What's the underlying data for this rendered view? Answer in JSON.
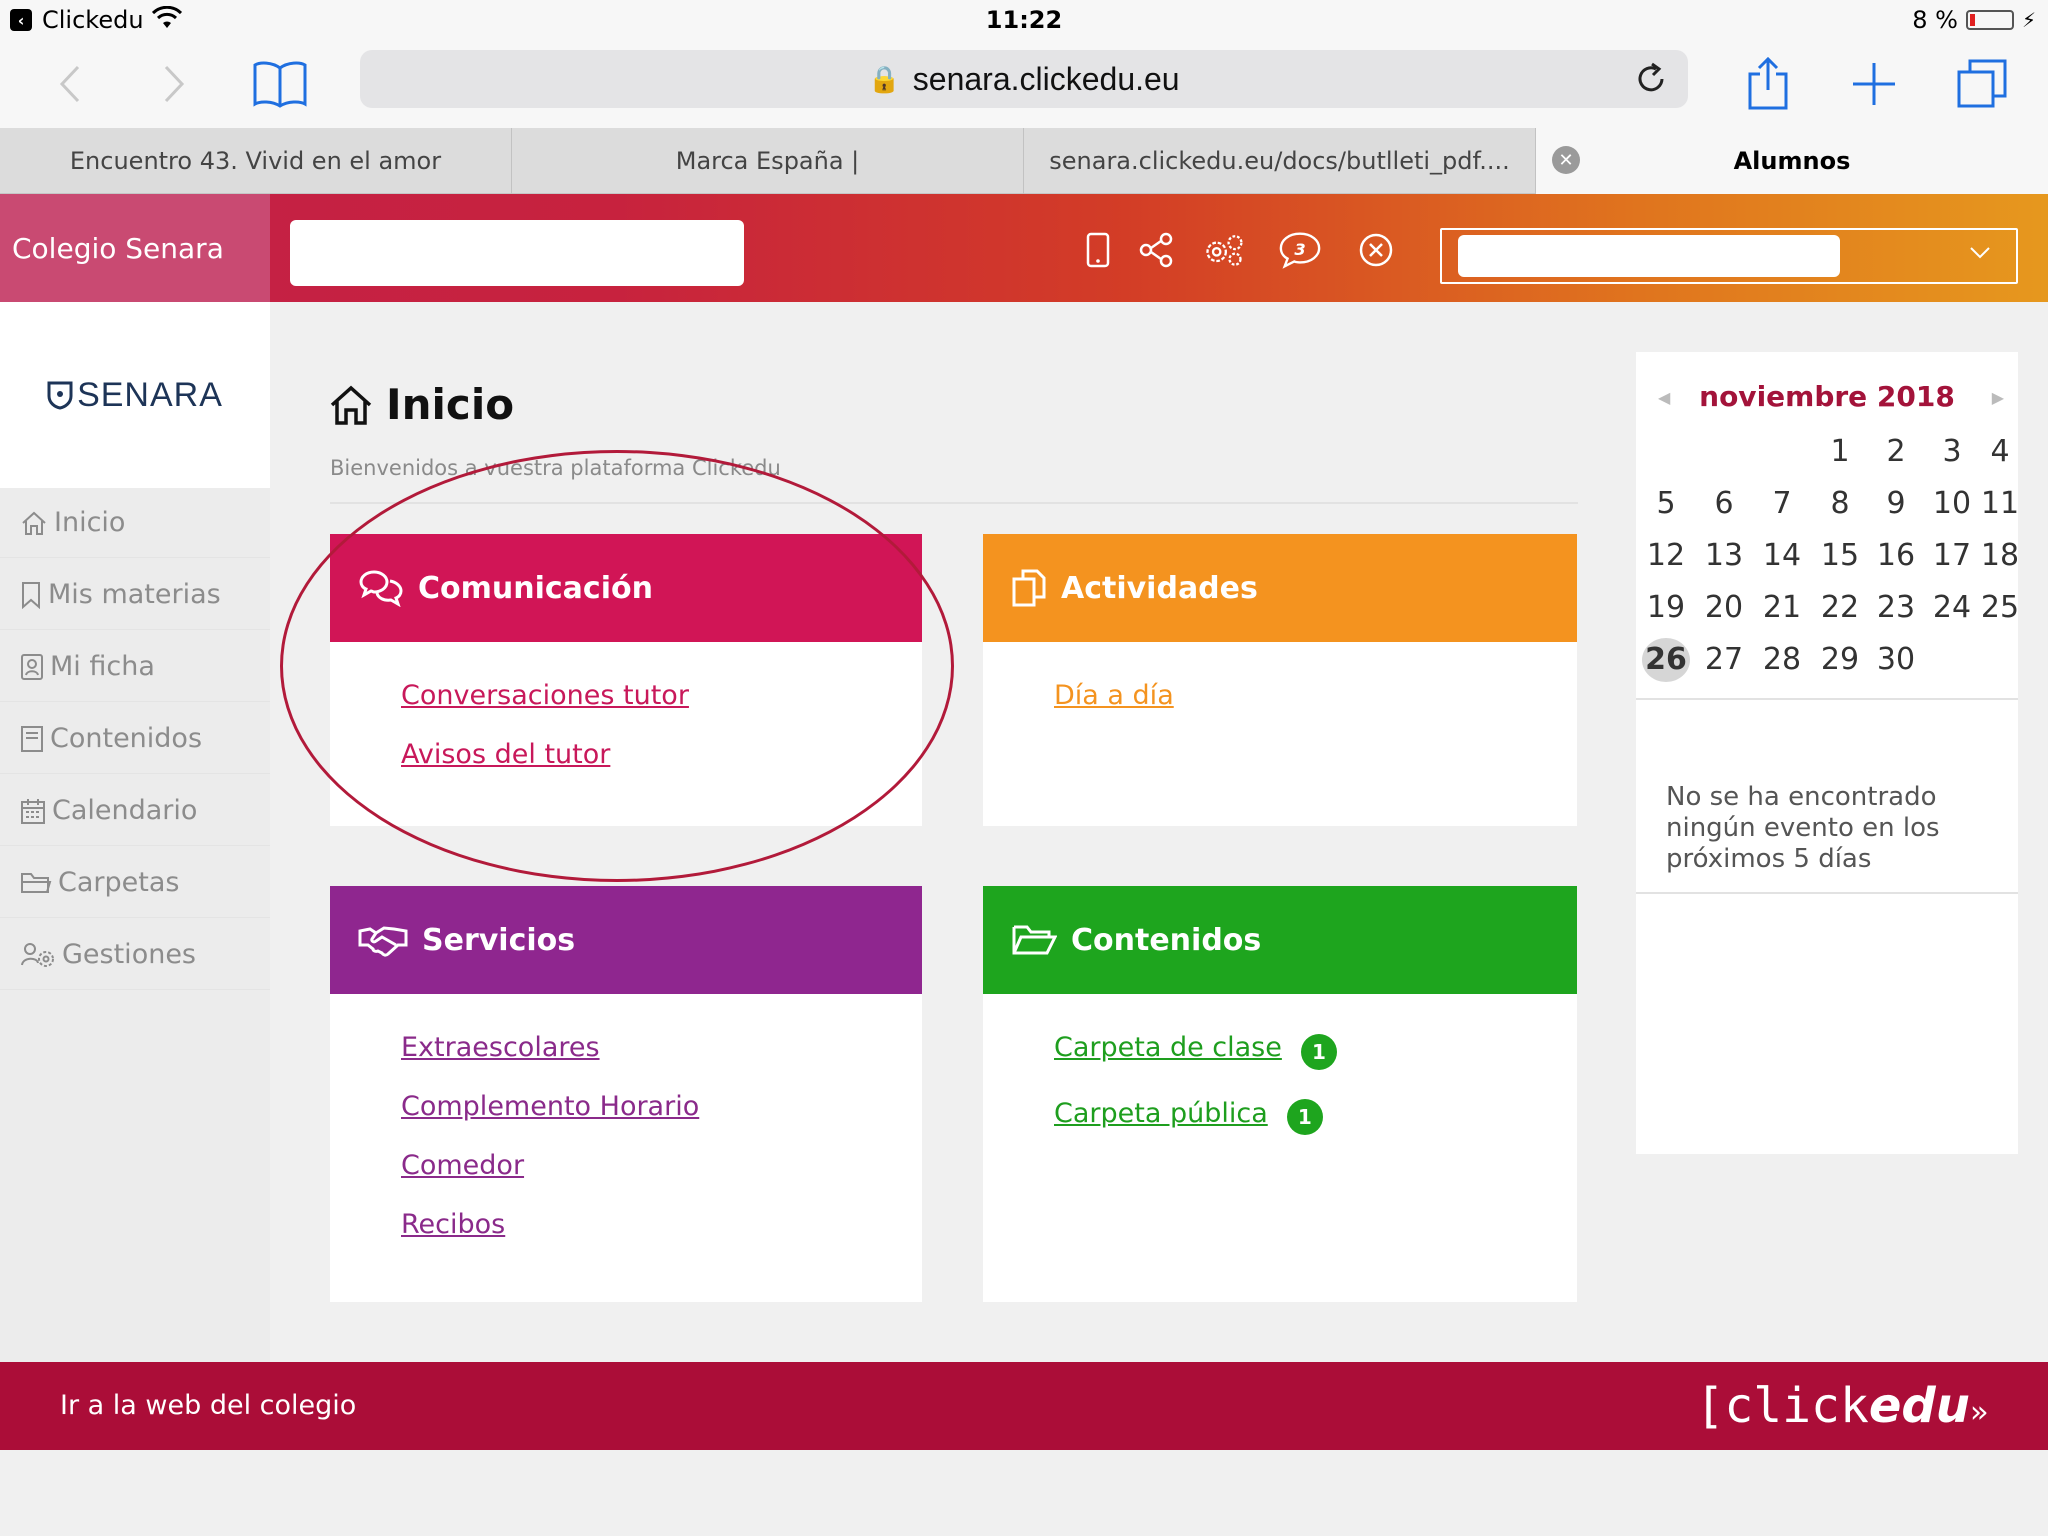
{
  "status_bar": {
    "back_app": "Clickedu",
    "time": "11:22",
    "battery": "8 %"
  },
  "browser": {
    "url": "senara.clickedu.eu",
    "tabs": [
      {
        "label": "Encuentro 43. Vivid en el amor"
      },
      {
        "label": "Marca España |"
      },
      {
        "label": "senara.clickedu.eu/docs/butlleti_pdf...."
      },
      {
        "label": "Alumnos"
      }
    ]
  },
  "header": {
    "brand": "Colegio Senara",
    "search_value": "",
    "user_select_value": "",
    "notifications_count": "3"
  },
  "sidebar": {
    "logo": "SENARA",
    "items": [
      {
        "label": "Inicio",
        "icon": "home-icon"
      },
      {
        "label": "Mis materias",
        "icon": "bookmark-icon"
      },
      {
        "label": "Mi ficha",
        "icon": "id-card-icon"
      },
      {
        "label": "Contenidos",
        "icon": "book-icon"
      },
      {
        "label": "Calendario",
        "icon": "calendar-icon"
      },
      {
        "label": "Carpetas",
        "icon": "folder-icon"
      },
      {
        "label": "Gestiones",
        "icon": "users-gear-icon"
      }
    ]
  },
  "main": {
    "title": "Inicio",
    "subtitle": "Bienvenidos a vuestra plataforma Clickedu",
    "cards": {
      "comunicacion": {
        "title": "Comunicación",
        "color": "#d11556",
        "links": [
          "Conversaciones tutor",
          "Avisos del tutor"
        ]
      },
      "actividades": {
        "title": "Actividades",
        "color": "#f4931f",
        "links": [
          "Día a día"
        ]
      },
      "servicios": {
        "title": "Servicios",
        "color": "#8f268f",
        "links": [
          "Extraescolares",
          "Complemento Horario",
          "Comedor",
          "Recibos"
        ]
      },
      "contenidos": {
        "title": "Contenidos",
        "color": "#1ea51e",
        "links": [
          "Carpeta de clase",
          "Carpeta pública"
        ],
        "badges": [
          "1",
          "1"
        ]
      }
    }
  },
  "calendar": {
    "month": "noviembre 2018",
    "today": "26",
    "weeks": [
      [
        "",
        "",
        "",
        "1",
        "2",
        "3",
        "4"
      ],
      [
        "5",
        "6",
        "7",
        "8",
        "9",
        "10",
        "11"
      ],
      [
        "12",
        "13",
        "14",
        "15",
        "16",
        "17",
        "18"
      ],
      [
        "19",
        "20",
        "21",
        "22",
        "23",
        "24",
        "25"
      ],
      [
        "26",
        "27",
        "28",
        "29",
        "30",
        "",
        ""
      ]
    ],
    "events_text": "No se ha encontrado ningún evento en los próximos 5 días"
  },
  "footer": {
    "link": "Ir a la web del colegio",
    "logo_left": "[click",
    "logo_right": "edu"
  },
  "colors": {
    "accent": "#ab0d38",
    "header_start": "#c32048",
    "header_end": "#e6981e"
  }
}
